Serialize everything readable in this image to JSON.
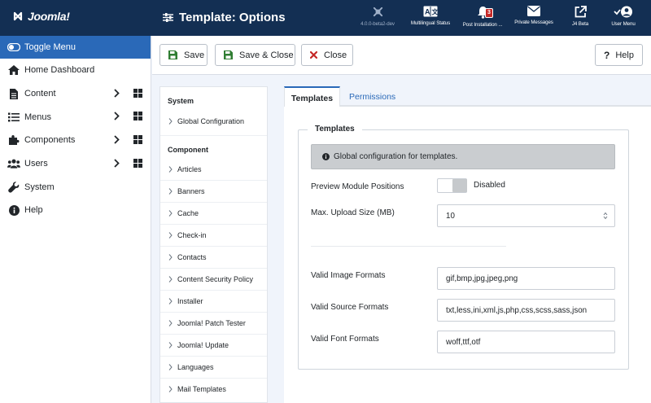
{
  "header": {
    "logo_text": "Joomla!",
    "title": "Template: Options",
    "items": [
      {
        "label": "4.0.0-beta2-dev",
        "icon": "joomla-icon"
      },
      {
        "label": "Multilingual Status",
        "icon": "language-icon"
      },
      {
        "label": "Post Installation ...",
        "icon": "bell-icon",
        "badge": "3"
      },
      {
        "label": "Private Messages",
        "icon": "envelope-icon"
      },
      {
        "label": "J4 Beta",
        "icon": "external-link-icon"
      },
      {
        "label": "User Menu",
        "icon": "user-icon"
      }
    ]
  },
  "sidebar": {
    "items": [
      {
        "label": "Toggle Menu",
        "icon": "toggle-icon"
      },
      {
        "label": "Home Dashboard",
        "icon": "home-icon"
      },
      {
        "label": "Content",
        "icon": "file-icon"
      },
      {
        "label": "Menus",
        "icon": "list-icon"
      },
      {
        "label": "Components",
        "icon": "puzzle-icon"
      },
      {
        "label": "Users",
        "icon": "users-icon"
      },
      {
        "label": "System",
        "icon": "wrench-icon"
      },
      {
        "label": "Help",
        "icon": "info-icon"
      }
    ]
  },
  "toolbar": {
    "save": "Save",
    "save_close": "Save & Close",
    "close": "Close",
    "help": "Help"
  },
  "options_nav": {
    "system_heading": "System",
    "system_items": [
      "Global Configuration"
    ],
    "component_heading": "Component",
    "component_items": [
      "Articles",
      "Banners",
      "Cache",
      "Check-in",
      "Contacts",
      "Content Security Policy",
      "Installer",
      "Joomla! Patch Tester",
      "Joomla! Update",
      "Languages",
      "Mail Templates"
    ]
  },
  "tabs": {
    "templates": "Templates",
    "permissions": "Permissions"
  },
  "form": {
    "legend": "Templates",
    "alert": "Global configuration for templates.",
    "preview_label": "Preview Module Positions",
    "preview_state": "Disabled",
    "upload_label": "Max. Upload Size (MB)",
    "upload_value": "10",
    "image_label": "Valid Image Formats",
    "image_value": "gif,bmp,jpg,jpeg,png",
    "source_label": "Valid Source Formats",
    "source_value": "txt,less,ini,xml,js,php,css,scss,sass,json",
    "font_label": "Valid Font Formats",
    "font_value": "woff,ttf,otf"
  },
  "colors": {
    "header_bg": "#132f53",
    "accent": "#2a69b8",
    "save_green": "#2f7d32",
    "close_red": "#c52827"
  }
}
